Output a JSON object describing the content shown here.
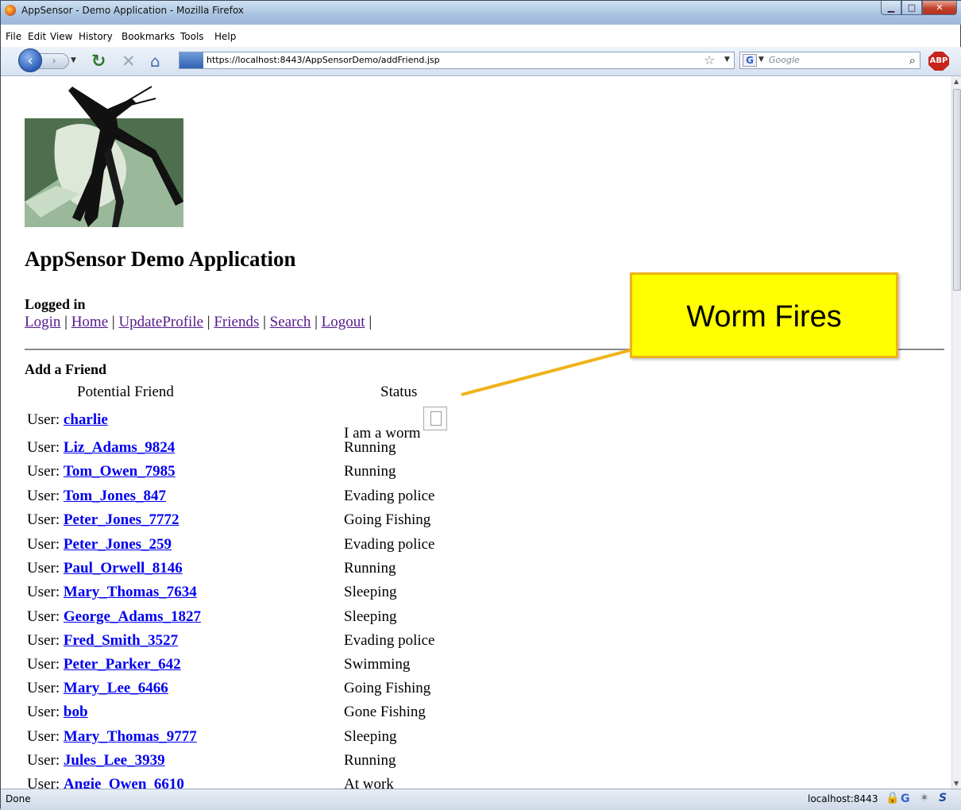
{
  "window": {
    "title": "AppSensor - Demo Application - Mozilla Firefox",
    "min_label": "▁",
    "max_label": "□",
    "close_label": "✕"
  },
  "menu": [
    "File",
    "Edit",
    "View",
    "History",
    "Bookmarks",
    "Tools",
    "Help"
  ],
  "nav": {
    "url": "https://localhost:8443/AppSensorDemo/addFriend.jsp",
    "search_placeholder": "Google",
    "search_engine": "G",
    "adblock_label": "ABP"
  },
  "page": {
    "title": "AppSensor Demo Application",
    "logged_in": "Logged in",
    "links": [
      "Login",
      "Home",
      "UpdateProfile",
      "Friends",
      "Search",
      "Logout"
    ],
    "section_title": "Add a Friend",
    "col_friend": "Potential Friend",
    "col_status": "Status",
    "user_prefix": "User: ",
    "rows": [
      {
        "name": "charlie",
        "status": "I am a worm"
      },
      {
        "name": "Liz_Adams_9824",
        "status": "Running"
      },
      {
        "name": "Tom_Owen_7985",
        "status": "Running"
      },
      {
        "name": "Tom_Jones_847",
        "status": "Evading police"
      },
      {
        "name": "Peter_Jones_7772",
        "status": "Going Fishing"
      },
      {
        "name": "Peter_Jones_259",
        "status": "Evading police"
      },
      {
        "name": "Paul_Orwell_8146",
        "status": "Running"
      },
      {
        "name": "Mary_Thomas_7634",
        "status": "Sleeping"
      },
      {
        "name": "George_Adams_1827",
        "status": "Sleeping"
      },
      {
        "name": "Fred_Smith_3527",
        "status": "Evading police"
      },
      {
        "name": "Peter_Parker_642",
        "status": "Swimming"
      },
      {
        "name": "Mary_Lee_6466",
        "status": "Going Fishing"
      },
      {
        "name": "bob",
        "status": "Gone Fishing"
      },
      {
        "name": "Mary_Thomas_9777",
        "status": "Sleeping"
      },
      {
        "name": "Jules_Lee_3939",
        "status": "Running"
      },
      {
        "name": "Angie_Owen_6610",
        "status": "At work"
      }
    ]
  },
  "callout": {
    "text": "Worm Fires"
  },
  "statusbar": {
    "left": "Done",
    "host": "localhost:8443"
  },
  "colors": {
    "callout_fill": "#ffff00",
    "callout_border": "#f0b21a",
    "link": "#0000ee",
    "visited_link": "#551a8b"
  }
}
